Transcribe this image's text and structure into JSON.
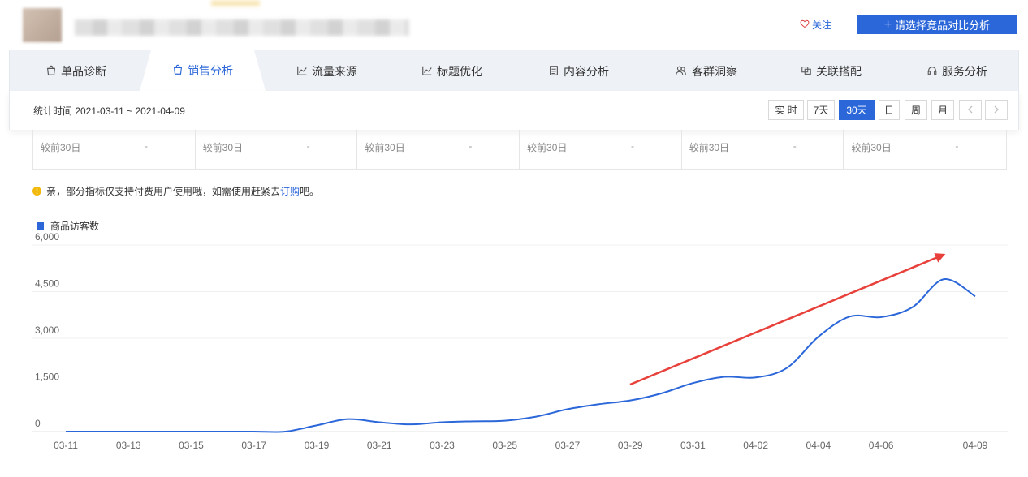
{
  "header": {
    "follow_label": "关注",
    "compare_label": "请选择竞品对比分析"
  },
  "tabs": [
    {
      "label": "单品诊断",
      "icon": "bag-icon",
      "active": false
    },
    {
      "label": "销售分析",
      "icon": "bag-icon",
      "active": true
    },
    {
      "label": "流量来源",
      "icon": "trend-icon",
      "active": false
    },
    {
      "label": "标题优化",
      "icon": "trend-icon",
      "active": false
    },
    {
      "label": "内容分析",
      "icon": "document-icon",
      "active": false
    },
    {
      "label": "客群洞察",
      "icon": "users-icon",
      "active": false
    },
    {
      "label": "关联搭配",
      "icon": "link-icon",
      "active": false
    },
    {
      "label": "服务分析",
      "icon": "headset-icon",
      "active": false
    }
  ],
  "date_range": {
    "label": "统计时间 2021-03-11 ~ 2021-04-09",
    "periods": [
      "实 时",
      "7天",
      "30天",
      "日",
      "周",
      "月"
    ],
    "active_period": "30天",
    "prev_icon": "chevron-left-icon",
    "next_icon": "chevron-right-icon"
  },
  "compare_strip": [
    {
      "label": "较前30日",
      "value": "-"
    },
    {
      "label": "较前30日",
      "value": "-"
    },
    {
      "label": "较前30日",
      "value": "-"
    },
    {
      "label": "较前30日",
      "value": "-"
    },
    {
      "label": "较前30日",
      "value": "-"
    },
    {
      "label": "较前30日",
      "value": "-"
    }
  ],
  "notice": {
    "icon": "info-icon",
    "text": "亲，部分指标仅支持付费用户使用哦，如需使用赶紧去",
    "link": "订购",
    "suffix": "吧。"
  },
  "colors": {
    "accent": "#2b67d9",
    "line": "#2b67d9",
    "arrow": "#e8403a",
    "active_tab_bg": "#ffffff",
    "tab_bar_bg": "#eef1f6"
  },
  "chart_data": {
    "type": "line",
    "title": "",
    "xlabel": "",
    "ylabel": "",
    "legend": "top-left",
    "grid": true,
    "ylim": [
      0,
      6000
    ],
    "yticks": [
      "0",
      "1,500",
      "3,000",
      "4,500",
      "6,000"
    ],
    "xticks": [
      "03-11",
      "03-13",
      "03-15",
      "03-17",
      "03-19",
      "03-21",
      "03-23",
      "03-25",
      "03-27",
      "03-29",
      "03-31",
      "04-02",
      "04-04",
      "04-06",
      "04-09"
    ],
    "series": [
      {
        "name": "商品访客数",
        "x": [
          "03-11",
          "03-12",
          "03-13",
          "03-14",
          "03-15",
          "03-16",
          "03-17",
          "03-18",
          "03-19",
          "03-20",
          "03-21",
          "03-22",
          "03-23",
          "03-24",
          "03-25",
          "03-26",
          "03-27",
          "03-28",
          "03-29",
          "03-30",
          "03-31",
          "04-01",
          "04-02",
          "04-03",
          "04-04",
          "04-05",
          "04-06",
          "04-07",
          "04-08",
          "04-09"
        ],
        "values": [
          0,
          0,
          0,
          0,
          0,
          0,
          0,
          0,
          200,
          400,
          300,
          230,
          300,
          330,
          350,
          480,
          720,
          880,
          1000,
          1230,
          1560,
          1760,
          1740,
          2050,
          3050,
          3700,
          3680,
          4000,
          4900,
          4350
        ]
      }
    ],
    "annotation": "red-arrow-upward-trend"
  }
}
